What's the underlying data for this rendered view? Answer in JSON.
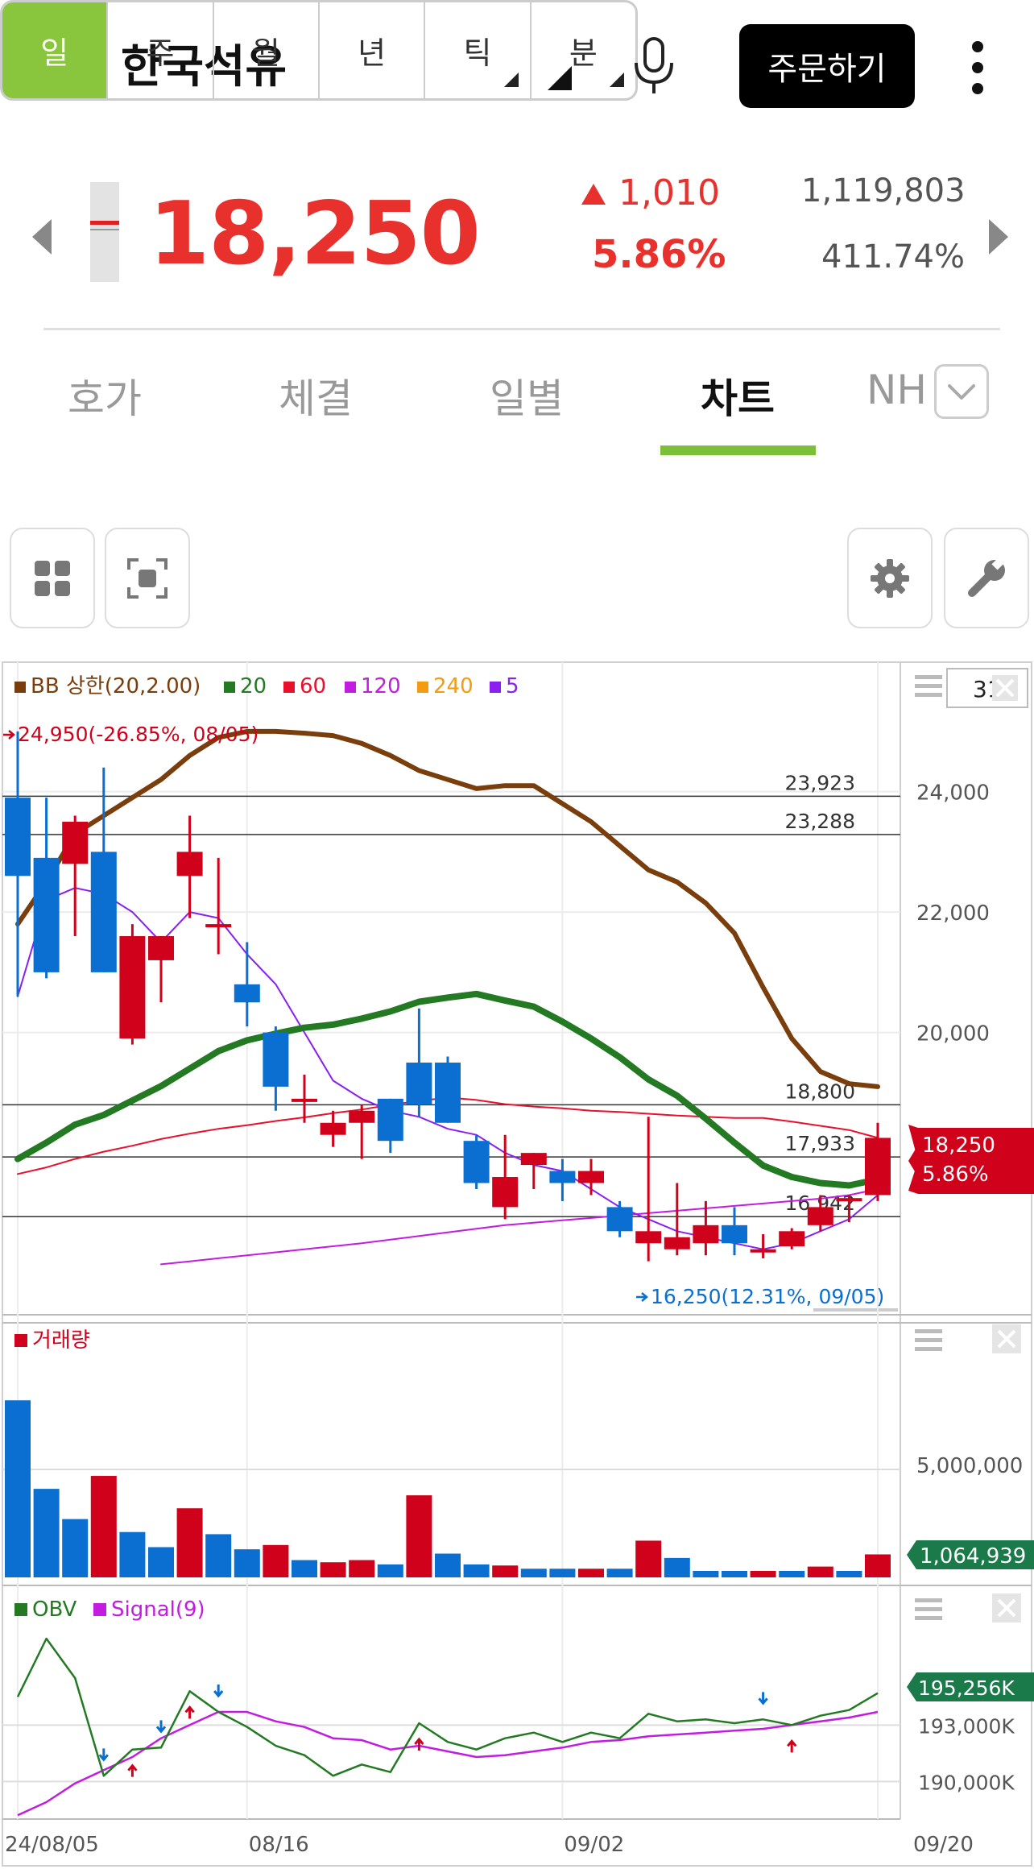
{
  "header": {
    "title": "한국석유",
    "order_label": "주문하기"
  },
  "quote": {
    "price": "18,250",
    "change": "1,010",
    "change_pct": "5.86%",
    "volume": "1,119,803",
    "volume_ratio": "411.74%"
  },
  "tabs": [
    {
      "label": "호가",
      "active": false
    },
    {
      "label": "체결",
      "active": false
    },
    {
      "label": "일별",
      "active": false
    },
    {
      "label": "차트",
      "active": true
    },
    {
      "label": "NH",
      "active": false
    }
  ],
  "periods": [
    {
      "label": "일",
      "active": true
    },
    {
      "label": "주",
      "active": false
    },
    {
      "label": "월",
      "active": false
    },
    {
      "label": "년",
      "active": false
    },
    {
      "label": "틱",
      "active": false,
      "submenu": true
    },
    {
      "label": "분",
      "active": false,
      "submenu": true
    }
  ],
  "colors": {
    "up": "#d0021b",
    "down": "#0a6fd1",
    "bb_upper": "#7a3e0c",
    "ma20": "#237a23",
    "ma60": "#e8102c",
    "ma120": "#c21ce0",
    "ma240": "#f39c12",
    "ma5": "#8a1ff0",
    "accent": "#8ac53e"
  },
  "chart_data": [
    {
      "type": "candlestick",
      "count_box": "31",
      "legend": [
        {
          "name": "BB 상한(20,2.00)",
          "color": "#7a3e0c"
        },
        {
          "name": "20",
          "color": "#237a23"
        },
        {
          "name": "60",
          "color": "#e8102c"
        },
        {
          "name": "120",
          "color": "#c21ce0"
        },
        {
          "name": "240",
          "color": "#f39c12"
        },
        {
          "name": "5",
          "color": "#8a1ff0"
        }
      ],
      "ylim": [
        15500,
        25400
      ],
      "y_ticks": [
        24000,
        22000,
        20000
      ],
      "y_tick_labels": [
        "24,000",
        "22,000",
        "20,000"
      ],
      "x_tick_labels": [
        "24/08/05",
        "08/16",
        "09/02",
        "09/20"
      ],
      "x_tick_index": [
        0,
        8,
        19,
        30
      ],
      "high_label": "24,950(-26.85%, 08/05)",
      "low_label": "16,250(12.31%, 09/05)",
      "levels": [
        {
          "value": 23923,
          "label": "23,923"
        },
        {
          "value": 23288,
          "label": "23,288"
        },
        {
          "value": 18800,
          "label": "18,800"
        },
        {
          "value": 17933,
          "label": "17,933"
        },
        {
          "value": 16942,
          "label": "16,942"
        }
      ],
      "current_price_tag": {
        "price": "18,250",
        "pct": "5.86%"
      },
      "candles": [
        {
          "o": 23900,
          "h": 25000,
          "l": 20600,
          "c": 22600
        },
        {
          "o": 22900,
          "h": 23900,
          "l": 20900,
          "c": 21000
        },
        {
          "o": 22800,
          "h": 23600,
          "l": 21600,
          "c": 23500
        },
        {
          "o": 23000,
          "h": 24400,
          "l": 21000,
          "c": 21000
        },
        {
          "o": 19900,
          "h": 21800,
          "l": 19800,
          "c": 21600
        },
        {
          "o": 21200,
          "h": 21600,
          "l": 20500,
          "c": 21600
        },
        {
          "o": 22600,
          "h": 23600,
          "l": 21900,
          "c": 23000
        },
        {
          "o": 21800,
          "h": 22900,
          "l": 21300,
          "c": 21800
        },
        {
          "o": 20800,
          "h": 21500,
          "l": 20100,
          "c": 20500
        },
        {
          "o": 20000,
          "h": 20100,
          "l": 18700,
          "c": 19100
        },
        {
          "o": 18900,
          "h": 19300,
          "l": 18500,
          "c": 18900
        },
        {
          "o": 18300,
          "h": 18700,
          "l": 18100,
          "c": 18500
        },
        {
          "o": 18500,
          "h": 18800,
          "l": 17900,
          "c": 18700
        },
        {
          "o": 18900,
          "h": 18900,
          "l": 18000,
          "c": 18200
        },
        {
          "o": 19500,
          "h": 20400,
          "l": 18600,
          "c": 18800
        },
        {
          "o": 19500,
          "h": 19600,
          "l": 18500,
          "c": 18500
        },
        {
          "o": 18200,
          "h": 18300,
          "l": 17400,
          "c": 17500
        },
        {
          "o": 17100,
          "h": 18300,
          "l": 16900,
          "c": 17600
        },
        {
          "o": 17800,
          "h": 18000,
          "l": 17400,
          "c": 18000
        },
        {
          "o": 17700,
          "h": 17900,
          "l": 17200,
          "c": 17500
        },
        {
          "o": 17500,
          "h": 17900,
          "l": 17300,
          "c": 17700
        },
        {
          "o": 17100,
          "h": 17200,
          "l": 16600,
          "c": 16700
        },
        {
          "o": 16500,
          "h": 18600,
          "l": 16200,
          "c": 16700
        },
        {
          "o": 16400,
          "h": 17500,
          "l": 16300,
          "c": 16600
        },
        {
          "o": 16500,
          "h": 17200,
          "l": 16300,
          "c": 16800
        },
        {
          "o": 16800,
          "h": 17100,
          "l": 16300,
          "c": 16500
        },
        {
          "o": 16400,
          "h": 16650,
          "l": 16250,
          "c": 16400
        },
        {
          "o": 16450,
          "h": 16750,
          "l": 16400,
          "c": 16700
        },
        {
          "o": 16800,
          "h": 17300,
          "l": 16700,
          "c": 17100
        },
        {
          "o": 17200,
          "h": 17300,
          "l": 16850,
          "c": 17250
        },
        {
          "o": 17300,
          "h": 18500,
          "l": 17200,
          "c": 18250
        }
      ],
      "bb_upper": [
        21800,
        22500,
        23300,
        23600,
        23900,
        24200,
        24600,
        24900,
        25000,
        25000,
        24970,
        24930,
        24800,
        24600,
        24350,
        24200,
        24050,
        24100,
        24100,
        23800,
        23500,
        23100,
        22700,
        22500,
        22150,
        21650,
        20750,
        19900,
        19350,
        19150,
        19100
      ],
      "ma20_start": 0,
      "ma20": [
        17900,
        18170,
        18470,
        18630,
        18870,
        19110,
        19400,
        19690,
        19870,
        19980,
        20080,
        20130,
        20230,
        20350,
        20510,
        20580,
        20640,
        20530,
        20430,
        20180,
        19900,
        19590,
        19220,
        18950,
        18570,
        18170,
        17790,
        17600,
        17500,
        17460,
        17560
      ],
      "ma60_start": 0,
      "ma60": [
        17650,
        17760,
        17900,
        18020,
        18120,
        18230,
        18320,
        18400,
        18460,
        18530,
        18590,
        18660,
        18720,
        18800,
        18860,
        18920,
        18880,
        18810,
        18770,
        18740,
        18700,
        18680,
        18650,
        18620,
        18600,
        18580,
        18580,
        18520,
        18450,
        18380,
        18250
      ],
      "ma120_start": 5,
      "ma120": [
        16150,
        16200,
        16250,
        16300,
        16350,
        16400,
        16450,
        16500,
        16560,
        16620,
        16680,
        16740,
        16800,
        16840,
        16880,
        16920,
        16960,
        17000,
        17040,
        17080,
        17120,
        17160,
        17200,
        17240,
        17300,
        17400
      ],
      "ma5_start": 0,
      "ma5": [
        20600,
        22200,
        22400,
        22300,
        22000,
        21500,
        22000,
        21900,
        21300,
        20800,
        20000,
        19200,
        18900,
        18700,
        18600,
        18400,
        18300,
        18000,
        17800,
        17700,
        17400,
        17100,
        16900,
        16700,
        16600,
        16500,
        16400,
        16500,
        16700,
        16900,
        17300
      ]
    },
    {
      "type": "bar",
      "title": "거래량",
      "y_tick_label": "5,000,000",
      "y_tick_value": 5000000,
      "ylim": [
        0,
        10000000
      ],
      "current_tag": "1,064,939",
      "current_value": 1064939,
      "values": [
        8200000,
        4100000,
        2700000,
        4700000,
        2100000,
        1400000,
        3200000,
        2000000,
        1300000,
        1500000,
        800000,
        700000,
        800000,
        600000,
        3800000,
        1100000,
        600000,
        550000,
        400000,
        400000,
        400000,
        400000,
        1700000,
        900000,
        300000,
        300000,
        300000,
        300000,
        500000,
        300000,
        1064939
      ],
      "up": [
        false,
        false,
        false,
        true,
        false,
        false,
        true,
        false,
        false,
        true,
        false,
        true,
        true,
        false,
        true,
        false,
        false,
        true,
        false,
        false,
        true,
        false,
        true,
        false,
        false,
        false,
        true,
        false,
        true,
        false,
        true
      ]
    },
    {
      "type": "line",
      "legend": [
        {
          "name": "OBV",
          "color": "#237a23"
        },
        {
          "name": "Signal(9)",
          "color": "#c21ce0"
        }
      ],
      "ylim": [
        188000,
        200000
      ],
      "y_ticks": [
        193000,
        190000
      ],
      "y_tick_labels": [
        "193,000K",
        "190,000K"
      ],
      "current_tag": "195,256K",
      "current_value": 195256,
      "obv": [
        194500,
        197600,
        195500,
        190300,
        191700,
        191800,
        194800,
        193700,
        192900,
        191900,
        191400,
        190300,
        190900,
        190500,
        193100,
        192100,
        191700,
        192300,
        192600,
        192100,
        192600,
        192300,
        193600,
        193200,
        193300,
        193100,
        193300,
        193000,
        193500,
        193800,
        194700
      ],
      "signal": [
        188200,
        188900,
        189900,
        190600,
        191300,
        192300,
        193000,
        193700,
        193700,
        193200,
        192900,
        192300,
        192200,
        191700,
        191900,
        191600,
        191300,
        191400,
        191600,
        191800,
        192100,
        192200,
        192400,
        192500,
        192600,
        192700,
        192800,
        193000,
        193200,
        193400,
        193700
      ],
      "up_arrows": [
        4,
        6,
        14,
        27
      ],
      "down_arrows": [
        3,
        5,
        7,
        26
      ]
    }
  ]
}
